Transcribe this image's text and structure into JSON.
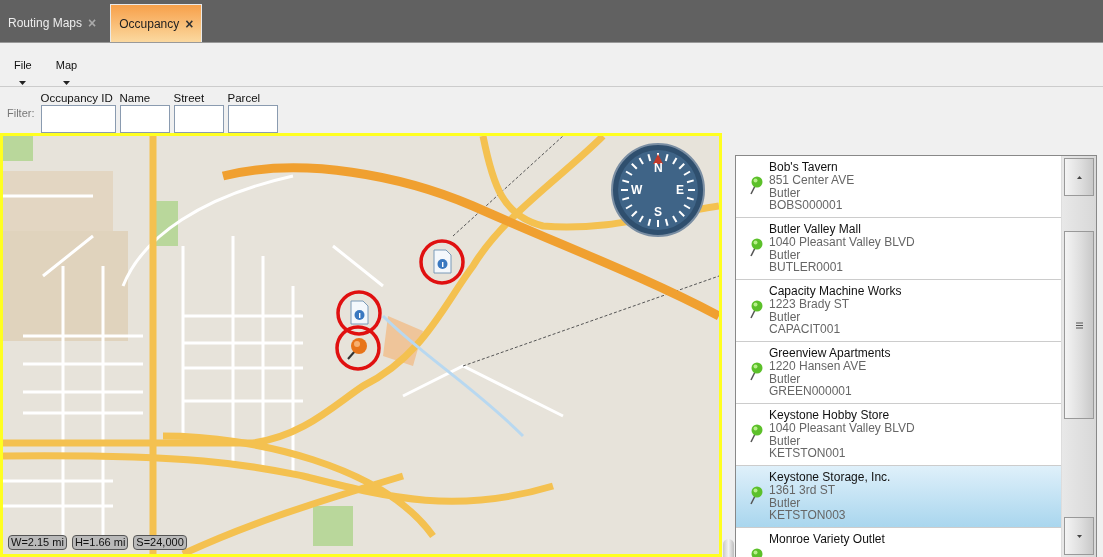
{
  "tabs": [
    {
      "label": "Routing Maps",
      "selected": false,
      "close": "×"
    },
    {
      "label": "Occupancy",
      "selected": true,
      "close": "×"
    }
  ],
  "menu": [
    {
      "label": "File"
    },
    {
      "label": "Map"
    }
  ],
  "filter": {
    "label": "Filter:",
    "fields": [
      {
        "label": "Occupancy ID"
      },
      {
        "label": "Name"
      },
      {
        "label": "Street"
      },
      {
        "label": "Parcel"
      }
    ]
  },
  "map": {
    "compass": {
      "north": "N",
      "east": "E",
      "south": "S",
      "west": "W"
    },
    "markers": [
      {
        "kind": "document"
      },
      {
        "kind": "document"
      },
      {
        "kind": "pushpin"
      }
    ],
    "scale": [
      "W=2.15 mi",
      "H=1.66 mi",
      "S=24,000"
    ]
  },
  "list": [
    {
      "name": "Bob's Tavern",
      "street": "851 Center AVE",
      "city": "Butler",
      "id": "BOBS000001",
      "selected": false
    },
    {
      "name": "Butler Valley Mall",
      "street": "1040 Pleasant Valley BLVD",
      "city": "Butler",
      "id": "BUTLER0001",
      "selected": false
    },
    {
      "name": "Capacity Machine Works",
      "street": "1223 Brady ST",
      "city": "Butler",
      "id": "CAPACIT001",
      "selected": false
    },
    {
      "name": "Greenview Apartments",
      "street": "1220 Hansen AVE",
      "city": "Butler",
      "id": "GREEN000001",
      "selected": false
    },
    {
      "name": "Keystone Hobby Store",
      "street": "1040 Pleasant Valley BLVD",
      "city": "Butler",
      "id": "KETSTON001",
      "selected": false
    },
    {
      "name": "Keystone Storage, Inc.",
      "street": "1361 3rd ST",
      "city": "Butler",
      "id": "KETSTON003",
      "selected": true
    },
    {
      "name": "Monroe Variety Outlet",
      "selected": false
    }
  ]
}
